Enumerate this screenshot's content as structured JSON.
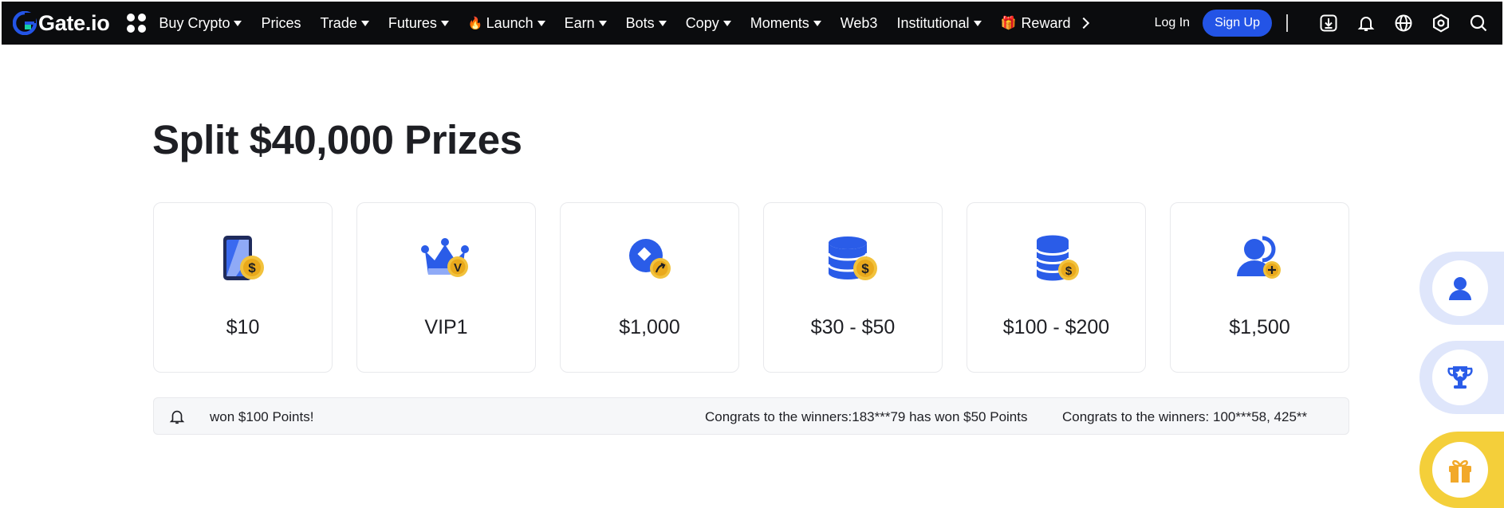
{
  "brand": {
    "name": "Gate.io"
  },
  "nav": {
    "items": [
      {
        "label": "Buy Crypto",
        "dropdown": true
      },
      {
        "label": "Prices",
        "dropdown": false
      },
      {
        "label": "Trade",
        "dropdown": true
      },
      {
        "label": "Futures",
        "dropdown": true
      },
      {
        "label": "Launch",
        "dropdown": true,
        "icon": "flame-icon"
      },
      {
        "label": "Earn",
        "dropdown": true
      },
      {
        "label": "Bots",
        "dropdown": true
      },
      {
        "label": "Copy",
        "dropdown": true
      },
      {
        "label": "Moments",
        "dropdown": true
      },
      {
        "label": "Web3",
        "dropdown": false
      },
      {
        "label": "Institutional",
        "dropdown": true
      },
      {
        "label": "Reward",
        "dropdown": false,
        "icon": "gift-icon"
      }
    ],
    "login_label": "Log In",
    "signup_label": "Sign Up",
    "tools": [
      "download-icon",
      "bell-icon",
      "globe-icon",
      "settings-icon",
      "search-icon"
    ]
  },
  "main": {
    "title": "Split $40,000 Prizes",
    "prizes": [
      {
        "value": "$10",
        "icon": "phone-coin-icon"
      },
      {
        "value": "VIP1",
        "icon": "crown-vip-icon"
      },
      {
        "value": "$1,000",
        "icon": "trade-coin-icon"
      },
      {
        "value": "$30 - $50",
        "icon": "coin-stack-icon"
      },
      {
        "value": "$100 - $200",
        "icon": "coin-tower-icon"
      },
      {
        "value": "$1,500",
        "icon": "user-add-icon"
      }
    ],
    "ticker": [
      "won $100 Points!",
      "Congrats to the winners:183***79 has won $50 Points",
      "Congrats to the winners: 100***58, 425**"
    ]
  },
  "side": [
    "user-icon",
    "trophy-icon",
    "gift-box-icon"
  ],
  "colors": {
    "accent": "#2354e6",
    "brand_blue": "#2a5ce8",
    "coin_yellow": "#f2c23c",
    "nav_bg": "#0b0c0e"
  }
}
